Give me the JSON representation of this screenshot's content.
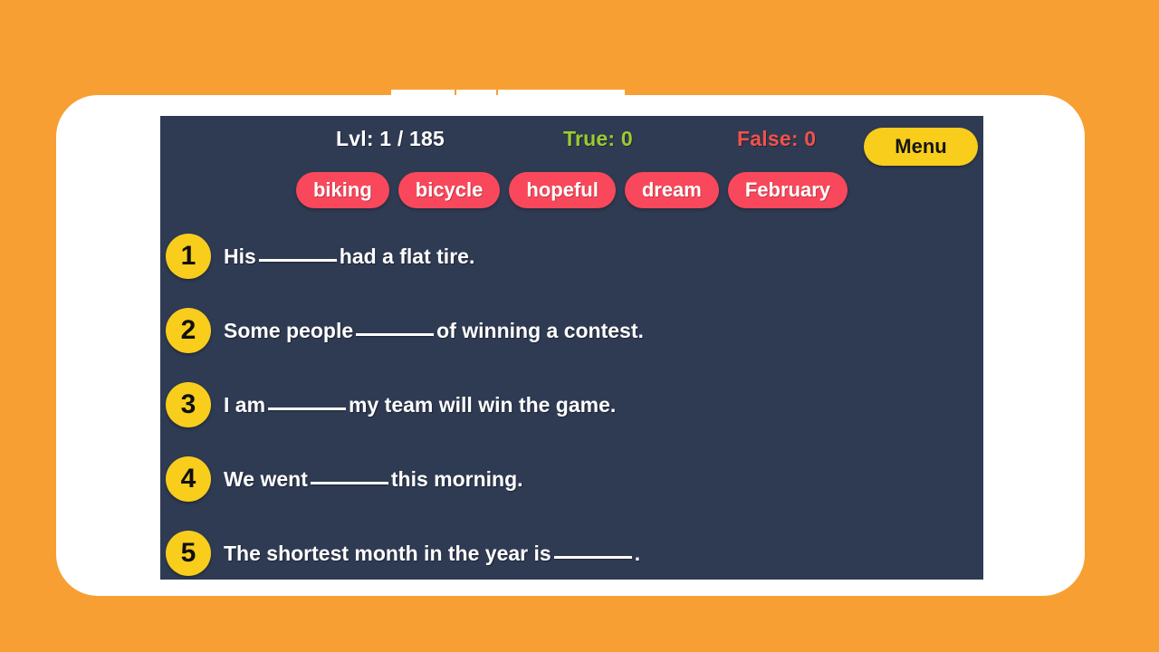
{
  "theme": {
    "page_background": "#f89f33",
    "device_frame": "#ffffff",
    "screen_background": "#2f3b53",
    "chip_color": "#f9485b",
    "badge_yellow": "#f8cd1c",
    "true_color": "#9ccc2e",
    "false_color": "#f2514c"
  },
  "statusbar": {
    "level_label": "Lvl: 1 / 185",
    "true_label": "True: 0",
    "false_label": "False: 0",
    "menu_label": "Menu"
  },
  "word_bank": [
    {
      "label": "biking"
    },
    {
      "label": "bicycle"
    },
    {
      "label": "hopeful"
    },
    {
      "label": "dream"
    },
    {
      "label": "February"
    }
  ],
  "questions": [
    {
      "number": "1",
      "before": "His",
      "after": "had a flat tire."
    },
    {
      "number": "2",
      "before": "Some people",
      "after": "of winning a contest."
    },
    {
      "number": "3",
      "before": "I am",
      "after": "my team will win the game."
    },
    {
      "number": "4",
      "before": "We went",
      "after": "this morning."
    },
    {
      "number": "5",
      "before": "The shortest month in the year is",
      "after": "."
    }
  ]
}
